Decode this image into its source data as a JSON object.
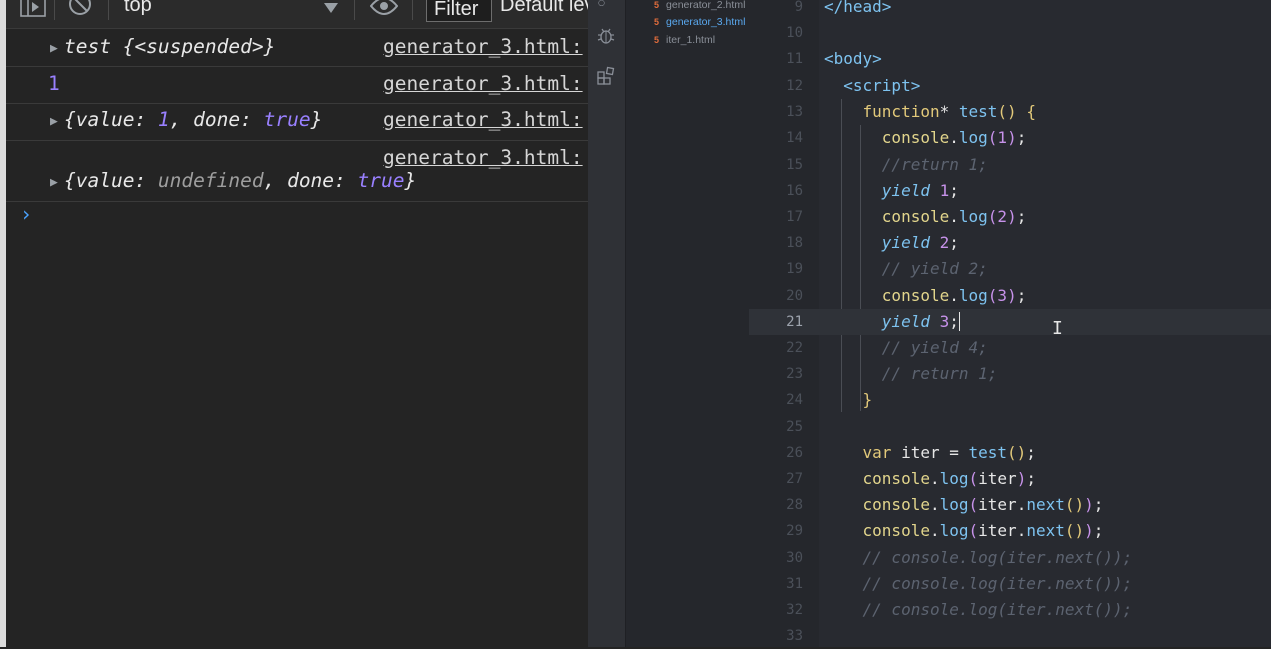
{
  "devtools": {
    "toolbar": {
      "context": "top",
      "filter_label": "Filter",
      "levels_label": "Default levels"
    },
    "messages": [
      {
        "text_parts": [
          "test {<suspended>}"
        ],
        "source": "generator_3.html:"
      },
      {
        "value": "1",
        "source": "generator_3.html:"
      },
      {
        "prefix": "{value: ",
        "val": "1",
        "mid": ", done: ",
        "done": "true",
        "suffix": "}",
        "source": "generator_3.html:"
      },
      {
        "prefix": "{value: ",
        "val": "undefined",
        "mid": ", done: ",
        "done": "true",
        "suffix": "}",
        "source": "generator_3.html:"
      }
    ],
    "prompt_symbol": "›"
  },
  "explorer": {
    "files": [
      {
        "name": "generator_2.html",
        "icon": "html-file-icon"
      },
      {
        "name": "generator_3.html",
        "icon": "html-file-icon",
        "selected": true
      },
      {
        "name": "iter_1.html",
        "icon": "html-file-icon"
      }
    ]
  },
  "editor": {
    "active_line": 21,
    "lines": [
      {
        "n": "9",
        "code": "</head>"
      },
      {
        "n": "10",
        "code": ""
      },
      {
        "n": "11",
        "code": "<body>"
      },
      {
        "n": "12",
        "code": "  <script>"
      },
      {
        "n": "13",
        "code": "    function* test() {"
      },
      {
        "n": "14",
        "code": "      console.log(1);"
      },
      {
        "n": "15",
        "code": "      //return 1;"
      },
      {
        "n": "16",
        "code": "      yield 1;"
      },
      {
        "n": "17",
        "code": "      console.log(2);"
      },
      {
        "n": "18",
        "code": "      yield 2;"
      },
      {
        "n": "19",
        "code": "      // yield 2;"
      },
      {
        "n": "20",
        "code": "      console.log(3);"
      },
      {
        "n": "21",
        "code": "      yield 3;"
      },
      {
        "n": "22",
        "code": "      // yield 4;"
      },
      {
        "n": "23",
        "code": "      // return 1;"
      },
      {
        "n": "24",
        "code": "    }"
      },
      {
        "n": "25",
        "code": ""
      },
      {
        "n": "26",
        "code": "    var iter = test();"
      },
      {
        "n": "27",
        "code": "    console.log(iter);"
      },
      {
        "n": "28",
        "code": "    console.log(iter.next());"
      },
      {
        "n": "29",
        "code": "    console.log(iter.next());"
      },
      {
        "n": "30",
        "code": "    // console.log(iter.next());"
      },
      {
        "n": "31",
        "code": "    // console.log(iter.next());"
      },
      {
        "n": "32",
        "code": "    // console.log(iter.next());"
      },
      {
        "n": "33",
        "code": ""
      }
    ]
  },
  "colors": {
    "console_bg": "#242424",
    "editor_bg": "#282a30",
    "keyword_yellow": "#e2c97a",
    "function_blue": "#7ec3f0",
    "number_purple": "#c792ea",
    "console_value_purple": "#9980ff",
    "comment_gray": "#5c6370"
  }
}
